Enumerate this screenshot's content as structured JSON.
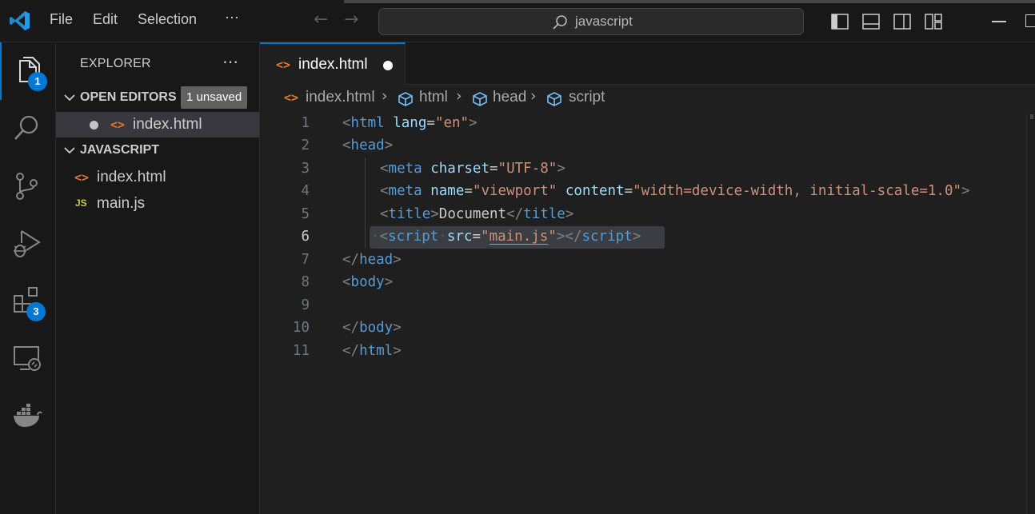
{
  "app": {
    "accent": "#0078d4"
  },
  "menu": [
    "File",
    "Edit",
    "Selection",
    "⋯"
  ],
  "search": {
    "text": "javascript"
  },
  "activity": {
    "explorer_badge": "1",
    "extensions_badge": "3"
  },
  "sidebar": {
    "title": "EXPLORER",
    "more": "⋯",
    "open_editors": {
      "label": "OPEN EDITORS",
      "badge": "1 unsaved",
      "files": [
        "index.html"
      ]
    },
    "folder": {
      "label": "JAVASCRIPT",
      "files": [
        {
          "name": "index.html",
          "icon": "html-file-icon",
          "badge": "<>"
        },
        {
          "name": "main.js",
          "icon": "js-file-icon",
          "badge": "JS"
        }
      ]
    }
  },
  "editor": {
    "tab": {
      "name": "index.html",
      "icon": "<>",
      "dirty": true
    },
    "breadcrumb": [
      "index.html",
      "html",
      "head",
      "script"
    ],
    "current_line": 6,
    "lines": [
      {
        "n": "1"
      },
      {
        "n": "2"
      },
      {
        "n": "3"
      },
      {
        "n": "4"
      },
      {
        "n": "5"
      },
      {
        "n": "6"
      },
      {
        "n": "7"
      },
      {
        "n": "8"
      },
      {
        "n": "9"
      },
      {
        "n": "10"
      },
      {
        "n": "11"
      }
    ],
    "code": {
      "l1": {
        "a": "<",
        "b": "html",
        "c": " lang",
        "d": "=",
        "e": "\"en\"",
        "f": ">"
      },
      "l2": {
        "a": "<",
        "b": "head",
        "c": ">"
      },
      "l3": {
        "a": "<",
        "b": "meta",
        "c": " charset",
        "d": "=",
        "e": "\"UTF-8\"",
        "f": ">"
      },
      "l4": {
        "a": "<",
        "b": "meta",
        "c": " name",
        "d": "=",
        "e": "\"viewport\"",
        "f": " content",
        "g": "=",
        "h": "\"width=device-width, initial-scale=1.0\"",
        "i": ">"
      },
      "l5": {
        "a": "<",
        "b": "title",
        "c": ">",
        "d": "Document",
        "e": "</",
        "f": "title",
        "g": ">"
      },
      "l6": {
        "ws": "·",
        "a": "<",
        "b": "script",
        "ws2": "·",
        "c": "src",
        "d": "=",
        "e": "\"",
        "f": "main.js",
        "g": "\"",
        "h": "></",
        "i": "script",
        "j": ">"
      },
      "l7": {
        "a": "</",
        "b": "head",
        "c": ">"
      },
      "l8": {
        "a": "<",
        "b": "body",
        "c": ">"
      },
      "l10": {
        "a": "</",
        "b": "body",
        "c": ">"
      },
      "l11": {
        "a": "</",
        "b": "html",
        "c": ">"
      }
    }
  }
}
